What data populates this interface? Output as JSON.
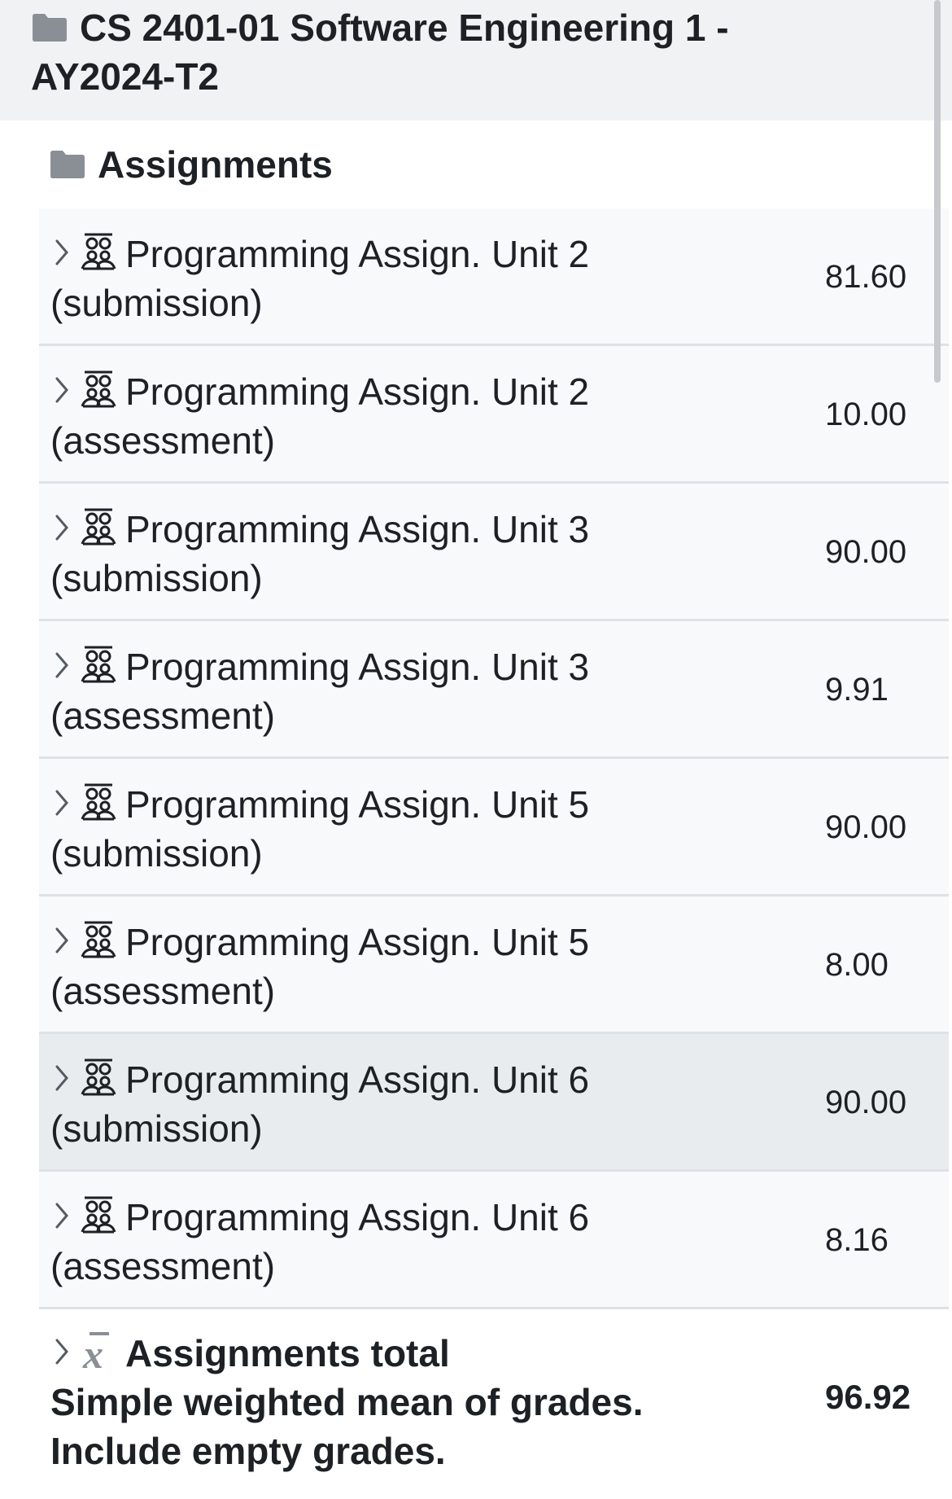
{
  "course": {
    "title": "CS 2401-01 Software Engineering 1 - AY2024-T2",
    "icon": "folder-icon"
  },
  "category": {
    "title": "Assignments",
    "icon": "folder-icon"
  },
  "items": [
    {
      "name": "Programming Assign. Unit 2 (submission)",
      "grade": "81.60",
      "icon": "workshop-icon"
    },
    {
      "name": "Programming Assign. Unit 2 (assessment)",
      "grade": "10.00",
      "icon": "workshop-icon"
    },
    {
      "name": "Programming Assign. Unit 3 (submission)",
      "grade": "90.00",
      "icon": "workshop-icon"
    },
    {
      "name": "Programming Assign. Unit 3 (assessment)",
      "grade": "9.91",
      "icon": "workshop-icon"
    },
    {
      "name": "Programming Assign. Unit 5 (submission)",
      "grade": "90.00",
      "icon": "workshop-icon"
    },
    {
      "name": "Programming Assign. Unit 5 (assessment)",
      "grade": "8.00",
      "icon": "workshop-icon"
    },
    {
      "name": "Programming Assign. Unit 6 (submission)",
      "grade": "90.00",
      "icon": "workshop-icon",
      "highlighted": true
    },
    {
      "name": "Programming Assign. Unit 6 (assessment)",
      "grade": "8.16",
      "icon": "workshop-icon"
    }
  ],
  "total": {
    "name": "Assignments total",
    "description": "Simple weighted mean of grades. Include empty grades.",
    "grade": "96.92",
    "icon": "mean-icon"
  },
  "colors": {
    "header_bg": "#f1f2f4",
    "row_bg": "#f8f9fa",
    "row_highlight_bg": "#e9ecef",
    "icon_gray": "#8a8f96"
  }
}
